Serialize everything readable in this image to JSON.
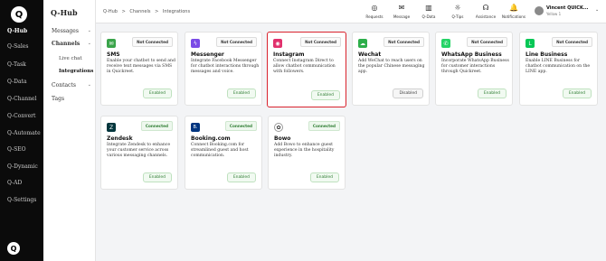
{
  "rail": {
    "logo": "Q",
    "items": [
      "Q-Hub",
      "Q-Sales",
      "Q-Task",
      "Q-Data",
      "Q-Channel",
      "Q-Convert",
      "Q-Automate",
      "Q-SEO",
      "Q-Dynamic",
      "Q-AD",
      "Q-Settings"
    ]
  },
  "nav": {
    "title": "Q-Hub",
    "messages": "Messages",
    "channels": "Channels",
    "live_chat": "Live chat",
    "integrations": "Integrations",
    "contacts": "Contacts",
    "tags": "Tags",
    "caret": "⌄"
  },
  "header": {
    "crumbs": [
      "Q-Hub",
      ">",
      "Channels",
      ">",
      "Integrations"
    ],
    "icons": [
      {
        "label": "Requests",
        "glyph": "◎"
      },
      {
        "label": "Message",
        "glyph": "✉"
      },
      {
        "label": "Q-Data",
        "glyph": "▥"
      },
      {
        "label": "Q-Tips",
        "glyph": "☼"
      },
      {
        "label": "Assistance",
        "glyph": "☊"
      },
      {
        "label": "Notifications",
        "glyph": "🔔"
      }
    ],
    "user_name": "Vincent QUICK...",
    "user_sub": "Yellow 1",
    "user_caret": "⌄"
  },
  "cards": [
    {
      "name": "SMS",
      "status": "Not Connected",
      "desc": "Enable your chatbot to send and receive text messages via SMS in Quickreet.",
      "action": "Enabled",
      "icon": "sms-icon",
      "color": "#3aa44a",
      "glyph": "✉"
    },
    {
      "name": "Messenger",
      "status": "Not Connected",
      "desc": "Integrate Facebook Messenger for chatbot interactions through messages and voice.",
      "action": "Enabled",
      "icon": "messenger-icon",
      "color": "#7a4be6",
      "glyph": "ϟ"
    },
    {
      "name": "Instagram",
      "status": "Not Connected",
      "desc": "Connect Instagram Direct to allow chatbot communication with followers.",
      "action": "Enabled",
      "icon": "instagram-icon",
      "color": "#e1306c",
      "glyph": "◉"
    },
    {
      "name": "Wechat",
      "status": "Not Connected",
      "desc": "Add WeChat to reach users on the popular Chinese messaging app.",
      "action": "Disabled",
      "icon": "wechat-icon",
      "color": "#2dae4a",
      "glyph": "☁"
    },
    {
      "name": "WhatsApp Business",
      "status": "Not Connected",
      "desc": "Incorporate WhatsApp Business for customer interactions through Quickreet.",
      "action": "Enabled",
      "icon": "whatsapp-icon",
      "color": "#25d366",
      "glyph": "✆"
    },
    {
      "name": "Line Business",
      "status": "Not Connected",
      "desc": "Enable LINE Business for chatbot communication on the LINE app.",
      "action": "Enabled",
      "icon": "line-icon",
      "color": "#06c755",
      "glyph": "L"
    },
    {
      "name": "Zendesk",
      "status": "Connected",
      "desc": "Integrate Zendesk to enhance your customer service across various messaging channels.",
      "action": "Enabled",
      "icon": "zendesk-icon",
      "color": "#03363d",
      "glyph": "Z"
    },
    {
      "name": "Booking.com",
      "status": "Connected",
      "desc": "Connect Booking.com for streamlined guest and host communication.",
      "action": "Enabled",
      "icon": "booking-icon",
      "color": "#003580",
      "glyph": "B."
    },
    {
      "name": "Bowo",
      "status": "Connected",
      "desc": "Add Bowo to enhance guest experience in the hospitality industry.",
      "action": "Enabled",
      "icon": "bowo-icon",
      "color": "#222222",
      "glyph": "✿"
    }
  ]
}
